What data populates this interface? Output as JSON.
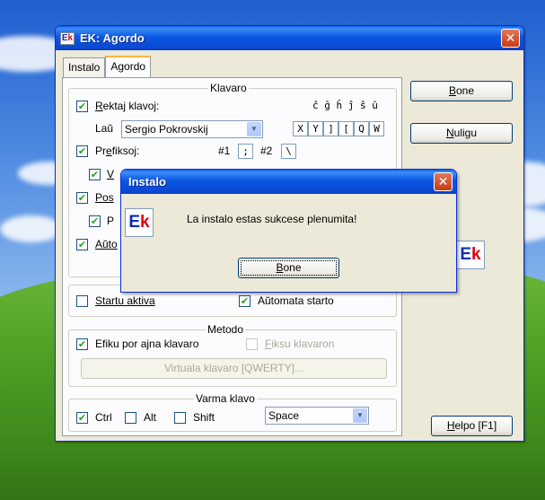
{
  "window": {
    "title": "EK: Agordo",
    "app_icon": "ek-logo-icon",
    "close_glyph": "✕"
  },
  "tabs": [
    {
      "label": "Instalo",
      "active": false
    },
    {
      "label": "Agordo",
      "active": true
    }
  ],
  "klavaro": {
    "title": "Klavaro",
    "rektaj": {
      "prefix": "",
      "mnemonic": "R",
      "rest": "ektaj klavoj:",
      "checked": true
    },
    "special_letters": "ĉ ĝ ĥ ĵ ŝ ŭ",
    "lau_label": "Laŭ",
    "lau_value": "Sergio Pokrovskij",
    "keys": [
      "X",
      "Y",
      "]",
      "[",
      "Q",
      "W"
    ],
    "prefiksoj": {
      "prefix": "Pr",
      "mnemonic": "e",
      "rest": "fiksoj:",
      "checked": true
    },
    "hash1_label": "#1",
    "hash1_value": ";",
    "hash2_label": "#2",
    "hash2_value": "\\",
    "v_visible": "V",
    "pos_visible": "Pos",
    "p_visible": "P",
    "auto_visible": "Aŭto"
  },
  "startu": {
    "label_visible": "Startu aktiva",
    "auto_visible": "Aŭtomata starto"
  },
  "metodo": {
    "title": "Metodo",
    "efiku": {
      "label": "Efiku por ajna klavaro",
      "checked": true
    },
    "fiksu": {
      "prefix": "",
      "mnemonic": "F",
      "rest": "iksu klavaron",
      "checked": false
    },
    "virtuala_btn": "Virtuala klavaro [QWERTY]..."
  },
  "varma": {
    "title": "Varma klavo",
    "ctrl": {
      "label": "Ctrl",
      "checked": true
    },
    "alt": {
      "label": "Alt",
      "checked": false
    },
    "shift": {
      "label": "Shift",
      "checked": false
    },
    "key_value": "Space"
  },
  "side_buttons": {
    "bone": {
      "prefix": "",
      "mnemonic": "B",
      "rest": "one"
    },
    "nuligu": {
      "prefix": "",
      "mnemonic": "N",
      "rest": "uligu"
    },
    "helpo": {
      "prefix": "",
      "mnemonic": "H",
      "rest": "elpo [F1]"
    }
  },
  "dialog": {
    "title": "Instalo",
    "message": "La instalo estas sukcese plenumita!",
    "ok": {
      "prefix": "",
      "mnemonic": "B",
      "rest": "one"
    }
  },
  "logo": {
    "e": "E",
    "k": "k"
  },
  "checkmark": "✔",
  "arrow": "▼"
}
